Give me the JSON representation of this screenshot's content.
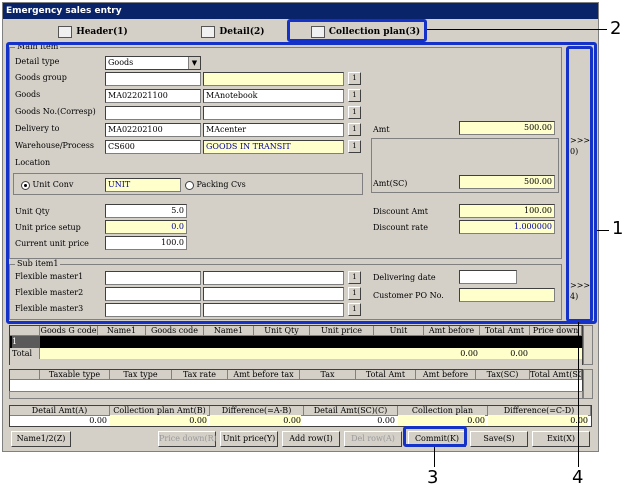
{
  "window": {
    "title": "Emergency sales entry"
  },
  "tabs": [
    {
      "label": "Header(1)"
    },
    {
      "label": "Detail(2)"
    },
    {
      "label": "Collection plan(3)"
    }
  ],
  "main_item": {
    "legend": "Main item",
    "detail_type_label": "Detail type",
    "detail_type_value": "Goods",
    "goods_group_label": "Goods group",
    "goods_label": "Goods",
    "goods_code": "MA022021100",
    "goods_name": "MAnotebook",
    "goods_no_label": "Goods No.(Corresp)",
    "delivery_to_label": "Delivery to",
    "delivery_code": "MA02202100",
    "delivery_name": "MAcenter",
    "warehouse_label": "Warehouse/Process",
    "warehouse_code": "CS600",
    "warehouse_name": "GOODS IN TRANSIT",
    "location_label": "Location",
    "unit_conv_label": "Unit Conv",
    "unit_conv_value": "UNIT",
    "packing_cvs_label": "Packing Cvs",
    "amt_label": "Amt",
    "amt_value": "500.00",
    "amt_sc_label": "Amt(SC)",
    "amt_sc_value": "500.00",
    "unit_qty_label": "Unit Qty",
    "unit_qty_value": "5.0",
    "unit_price_setup_label": "Unit price setup",
    "unit_price_setup_value": "0.0",
    "current_unit_price_label": "Current unit price",
    "current_unit_price_value": "100.0",
    "discount_amt_label": "Discount Amt",
    "discount_amt_value": "100.00",
    "discount_rate_label": "Discount rate",
    "discount_rate_value": "1.000000",
    "side_label": ">>>(\n0)",
    "btn_label": "1"
  },
  "sub_item": {
    "legend": "Sub item1",
    "flex1_label": "Flexible master1",
    "flex2_label": "Flexible master2",
    "flex3_label": "Flexible master3",
    "delivering_date_label": "Delivering date",
    "customer_po_label": "Customer PO No.",
    "side_label": ">>>(\n4)"
  },
  "grid1": {
    "headers": [
      "Goods G code",
      "Name1",
      "Goods code",
      "Name1",
      "Unit Qty",
      "Unit price",
      "Unit",
      "Amt before",
      "Total Amt",
      "Price down"
    ],
    "row1_label": "1",
    "total_label": "Total",
    "total_amt_before": "0.00",
    "total_amt": "0.00"
  },
  "grid2": {
    "headers": [
      "Taxable type",
      "Tax type",
      "Tax rate",
      "Amt before tax",
      "Tax",
      "Total Amt",
      "Amt before",
      "Tax(SC)",
      "Total Amt(SC)"
    ]
  },
  "summary": {
    "headers": [
      "Detail Amt(A)",
      "Collection plan Amt(B)",
      "Difference(=A-B)",
      "Detail Amt(SC)(C)",
      "Collection plan",
      "Difference(=C-D)"
    ],
    "values": [
      "0.00",
      "0.00",
      "0.00",
      "0.00",
      "0.00",
      "0.00"
    ]
  },
  "buttons": {
    "name1": "Name1/2(Z)",
    "price_down": "Price down(R)",
    "unit_price": "Unit price(Y)",
    "add_row": "Add row(I)",
    "del_row": "Del row(A)",
    "commit": "Commit(K)",
    "save": "Save(S)",
    "exit": "Exit(X)"
  },
  "callouts": {
    "c1": "1",
    "c2": "2",
    "c3": "3",
    "c4": "4"
  },
  "colors": {
    "title_bar": "#0a246a",
    "callout": "#1431c8",
    "readonly_field": "#ffffcc",
    "window_bg": "#d4d0c8"
  }
}
